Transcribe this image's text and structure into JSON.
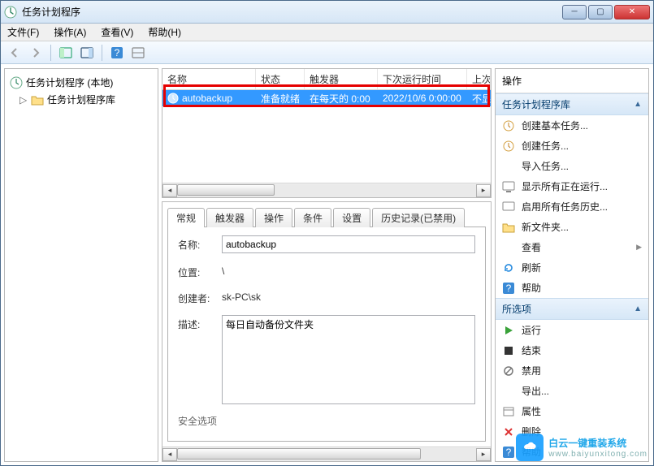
{
  "window": {
    "title": "任务计划程序"
  },
  "menubar": {
    "file": "文件(F)",
    "action": "操作(A)",
    "view": "查看(V)",
    "help": "帮助(H)"
  },
  "tree": {
    "root": "任务计划程序 (本地)",
    "library": "任务计划程序库"
  },
  "list": {
    "columns": {
      "name": "名称",
      "status": "状态",
      "triggers": "触发器",
      "nextRun": "下次运行时间",
      "lastRun": "上次"
    },
    "row": {
      "name": "autobackup",
      "status": "准备就绪",
      "triggers": "在每天的 0:00",
      "nextRun": "2022/10/6 0:00:00",
      "lastRun": "不显"
    }
  },
  "tabs": {
    "general": "常规",
    "triggers": "触发器",
    "actions": "操作",
    "conditions": "条件",
    "settings": "设置",
    "history": "历史记录(已禁用)"
  },
  "general": {
    "name_label": "名称:",
    "name_value": "autobackup",
    "location_label": "位置:",
    "location_value": "\\",
    "author_label": "创建者:",
    "author_value": "sk-PC\\sk",
    "desc_label": "描述:",
    "desc_value": "每日自动备份文件夹",
    "security_label": "安全选项"
  },
  "actions": {
    "pane_title": "操作",
    "section_library": "任务计划程序库",
    "create_basic": "创建基本任务...",
    "create_task": "创建任务...",
    "import_task": "导入任务...",
    "show_running": "显示所有正在运行...",
    "enable_history": "启用所有任务历史...",
    "new_folder": "新文件夹...",
    "view": "查看",
    "refresh": "刷新",
    "help": "帮助",
    "section_selected": "所选项",
    "run": "运行",
    "end": "结束",
    "disable": "禁用",
    "export": "导出...",
    "properties": "属性",
    "delete": "删除"
  },
  "watermark": {
    "text": "白云一键重装系统",
    "sub": "www.baiyunxitong.com"
  }
}
